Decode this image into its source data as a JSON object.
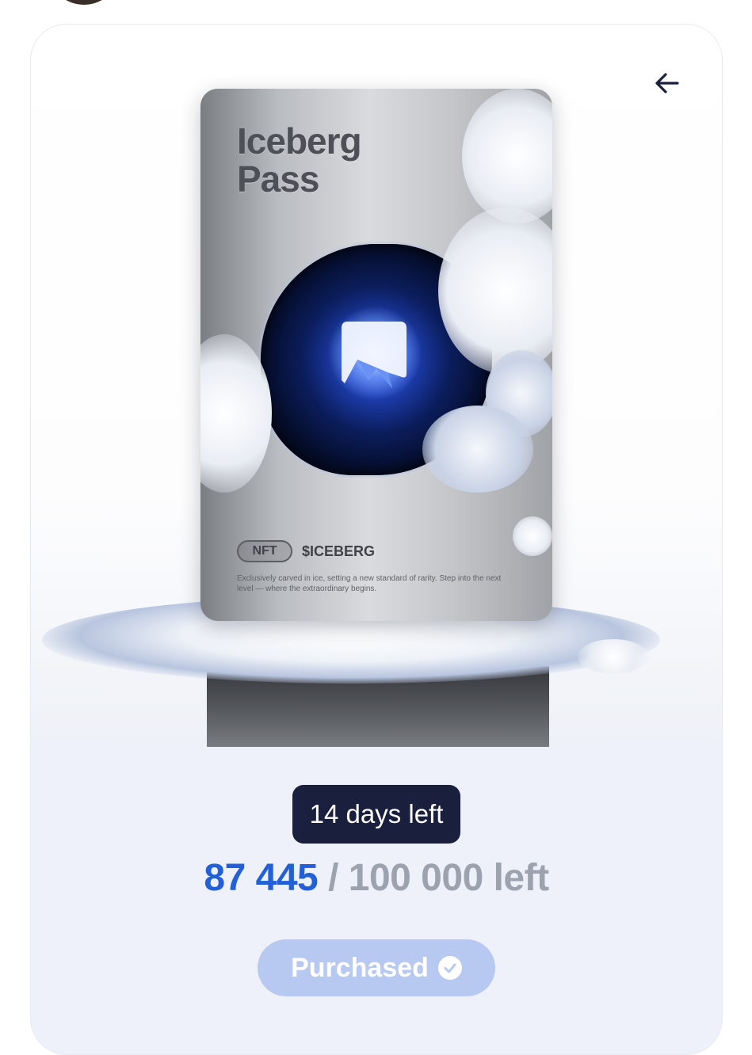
{
  "card": {
    "title_line1": "Iceberg",
    "title_line2": "Pass",
    "nft_label": "NFT",
    "brand": "$ICEBERG",
    "description": "Exclusively carved in ice, setting a new standard of rarity. Step into the next level — where the extraordinary begins."
  },
  "status": {
    "days_left": "14 days left",
    "current_count": "87 445",
    "separator": "/",
    "total_text": "100 000 left"
  },
  "action": {
    "purchased_label": "Purchased"
  },
  "colors": {
    "accent_blue": "#2360d8",
    "badge_dark": "#1a1f3d",
    "button_disabled": "#b7c9f0"
  },
  "icons": {
    "back": "arrow-left-icon",
    "check": "check-circle-icon"
  }
}
